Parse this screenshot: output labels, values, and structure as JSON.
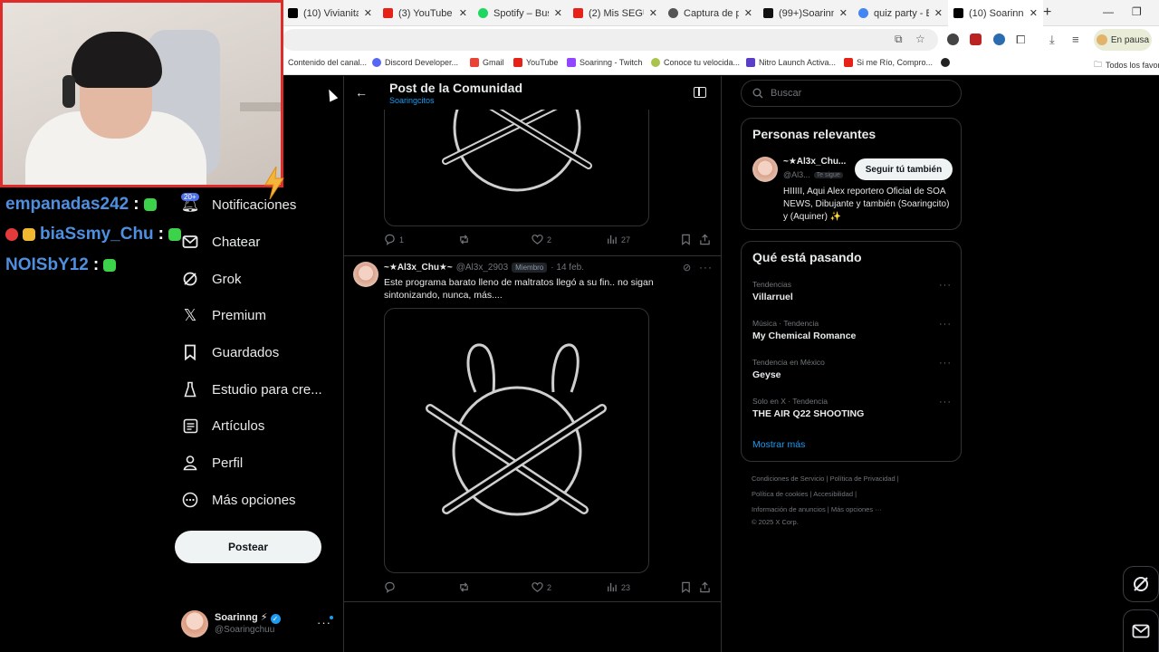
{
  "browser": {
    "tabs": [
      {
        "label": "(10) Vivianita 🔸",
        "color": "#000000"
      },
      {
        "label": "(3) YouTube",
        "color": "#e62117"
      },
      {
        "label": "Spotify – Buscar",
        "color": "#1ed760"
      },
      {
        "label": "(2) Mis SEGUID",
        "color": "#e62117"
      },
      {
        "label": "Captura de pan",
        "color": "#555555"
      },
      {
        "label": "(99+)Soarinng",
        "color": "#111111"
      },
      {
        "label": "quiz party - Bu",
        "color": "#4285f4"
      },
      {
        "label": "(10) Soarinng",
        "color": "#000000"
      }
    ],
    "pause_label": "En pausa",
    "bookmarks": [
      {
        "label": "Contenido del canal...",
        "color": "#e62117"
      },
      {
        "label": "Discord Developer...",
        "color": "#5865f2"
      },
      {
        "label": "Gmail",
        "color": "#ea4335"
      },
      {
        "label": "YouTube",
        "color": "#e62117"
      },
      {
        "label": "Soarinng - Twitch",
        "color": "#9146ff"
      },
      {
        "label": "Conoce tu velocida...",
        "color": "#aac34b"
      },
      {
        "label": "Nitro Launch Activa...",
        "color": "#5a3ec8"
      },
      {
        "label": "Si me Río, Compro...",
        "color": "#e62117"
      },
      {
        "label": "Todos los favor",
        "color": "#555555"
      }
    ]
  },
  "stream_chat": [
    {
      "name": "empanadas242",
      "colon": ":"
    },
    {
      "name": "biaSsmy_Chu",
      "colon": ":"
    },
    {
      "name": "NOISbY12",
      "colon": ":"
    }
  ],
  "chat_badge": "20+",
  "nav": {
    "items": [
      {
        "label": "Notificaciones",
        "icon": "bell-icon"
      },
      {
        "label": "Chatear",
        "icon": "mail-icon"
      },
      {
        "label": "Grok",
        "icon": "grok-icon"
      },
      {
        "label": "Premium",
        "icon": "x-logo-icon"
      },
      {
        "label": "Guardados",
        "icon": "bookmark-icon"
      },
      {
        "label": "Estudio para cre...",
        "icon": "flask-icon"
      },
      {
        "label": "Artículos",
        "icon": "article-icon"
      },
      {
        "label": "Perfil",
        "icon": "person-icon"
      },
      {
        "label": "Más opciones",
        "icon": "more-circle-icon"
      }
    ],
    "post_button": "Postear"
  },
  "account": {
    "name": "Soarinng ⚡",
    "handle": "@Soaringchuu"
  },
  "header": {
    "title": "Post de la Comunidad",
    "subtitle": "Soaringcitos"
  },
  "post1_stats": {
    "replies": "1",
    "reposts": "",
    "likes": "2",
    "views": "27"
  },
  "reply": {
    "name": "~★Al3x_Chu★~",
    "handle": "@Al3x_2903",
    "role": "Miembro",
    "date": "· 14 feb.",
    "text": "Este programa barato lleno de maltratos llegó a su fin.. no sigan sintonizando, nunca, más....",
    "stats": {
      "replies": "",
      "reposts": "",
      "likes": "2",
      "views": "23"
    }
  },
  "sidebar": {
    "search_placeholder": "Buscar",
    "relevant_title": "Personas relevantes",
    "relevant": {
      "name": "~★Al3x_Chu...",
      "handle": "@Al3...",
      "follows_you": "Te sigue",
      "follow_button": "Seguir tú también",
      "bio": "HIIIII, Aqui Alex reportero Oficial de SOA NEWS, Dibujante y también (Soaringcito) y (Aquiner) ✨"
    },
    "trends_title": "Qué está pasando",
    "trends": [
      {
        "context": "Tendencias",
        "name": "Villarruel"
      },
      {
        "context": "Música · Tendencia",
        "name": "My Chemical Romance"
      },
      {
        "context": "Tendencia en México",
        "name": "Geyse"
      },
      {
        "context": "Solo en X · Tendencia",
        "name": "THE AIR Q22 SHOOTING"
      }
    ],
    "show_more": "Mostrar más",
    "footer": [
      "Condiciones de Servicio  |  Política de Privacidad  |",
      "Política de cookies  |  Accesibilidad  |",
      "Información de anuncios  |  Más opciones ···",
      "© 2025 X Corp."
    ]
  },
  "colors": {
    "accent": "#1d9bf0",
    "background": "#000000",
    "border": "#2f3336",
    "webcam_border": "#e02b2b",
    "chat_name": "#4f8fe0"
  }
}
